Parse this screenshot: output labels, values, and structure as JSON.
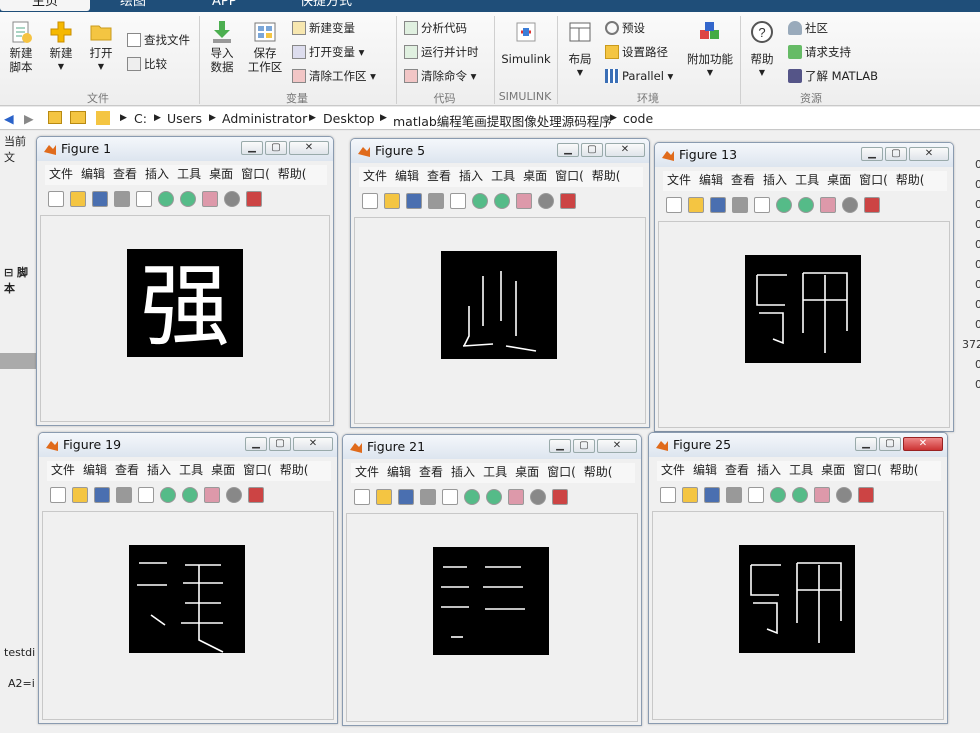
{
  "tabs": [
    "主页",
    "绘图",
    "APP",
    "快捷方式"
  ],
  "ribbon": {
    "file_group": {
      "new_script": [
        "新建",
        "脚本"
      ],
      "new": "新建",
      "open": "打开",
      "find_files": "查找文件",
      "compare": "比较",
      "label": "文件"
    },
    "var_group": {
      "import": [
        "导入",
        "数据"
      ],
      "save_ws": [
        "保存",
        "工作区"
      ],
      "new_var": "新建变量",
      "open_var": "打开变量",
      "clear_ws": "清除工作区",
      "label": "变量"
    },
    "code_group": {
      "analyze": "分析代码",
      "run_time": "运行并计时",
      "clear_cmd": "清除命令",
      "label": "代码"
    },
    "simulink_group": {
      "simulink": "Simulink",
      "label": "SIMULINK"
    },
    "env_group": {
      "layout": "布局",
      "prefs": "预设",
      "set_path": "设置路径",
      "parallel": "Parallel",
      "addons": "附加功能",
      "label": "环境"
    },
    "res_group": {
      "help": "帮助",
      "community": "社区",
      "support": "请求支持",
      "learn": "了解 MATLAB",
      "label": "资源"
    }
  },
  "address": {
    "crumbs": [
      "C:",
      "Users",
      "Administrator",
      "Desktop",
      "matlab编程笔画提取图像处理源码程序",
      "code"
    ]
  },
  "background": {
    "current_folder": "当前文",
    "script": "脚本",
    "workspace_label": "testdi",
    "cmd": "A2=i",
    "right_values": [
      "0",
      "0",
      "0",
      "0",
      "0",
      "0",
      "0",
      "0",
      "0",
      "372",
      "0",
      "0"
    ]
  },
  "figure_menu": [
    "文件",
    "编辑",
    "查看",
    "插入",
    "工具",
    "桌面",
    "窗口(",
    "帮助("
  ],
  "figures": [
    {
      "title": "Figure 1",
      "glyph": "强"
    },
    {
      "title": "Figure 5"
    },
    {
      "title": "Figure 13"
    },
    {
      "title": "Figure 19"
    },
    {
      "title": "Figure 21"
    },
    {
      "title": "Figure 25"
    }
  ],
  "colors": {
    "tabbar": "#1f4e79",
    "axes_bg": "#000000",
    "stroke": "#ffffff",
    "close_active": "#c33333"
  }
}
